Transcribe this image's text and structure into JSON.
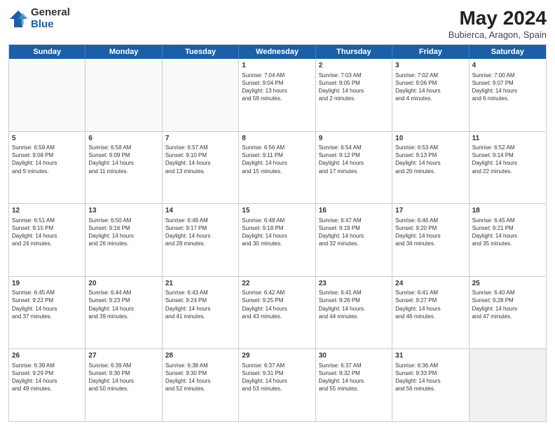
{
  "header": {
    "logo_general": "General",
    "logo_blue": "Blue",
    "month_title": "May 2024",
    "location": "Bubierca, Aragon, Spain"
  },
  "weekdays": [
    "Sunday",
    "Monday",
    "Tuesday",
    "Wednesday",
    "Thursday",
    "Friday",
    "Saturday"
  ],
  "rows": [
    [
      {
        "day": "",
        "info": "",
        "empty": true
      },
      {
        "day": "",
        "info": "",
        "empty": true
      },
      {
        "day": "",
        "info": "",
        "empty": true
      },
      {
        "day": "1",
        "info": "Sunrise: 7:04 AM\nSunset: 9:04 PM\nDaylight: 13 hours\nand 59 minutes."
      },
      {
        "day": "2",
        "info": "Sunrise: 7:03 AM\nSunset: 9:05 PM\nDaylight: 14 hours\nand 2 minutes."
      },
      {
        "day": "3",
        "info": "Sunrise: 7:02 AM\nSunset: 9:06 PM\nDaylight: 14 hours\nand 4 minutes."
      },
      {
        "day": "4",
        "info": "Sunrise: 7:00 AM\nSunset: 9:07 PM\nDaylight: 14 hours\nand 6 minutes."
      }
    ],
    [
      {
        "day": "5",
        "info": "Sunrise: 6:59 AM\nSunset: 9:08 PM\nDaylight: 14 hours\nand 9 minutes."
      },
      {
        "day": "6",
        "info": "Sunrise: 6:58 AM\nSunset: 9:09 PM\nDaylight: 14 hours\nand 11 minutes."
      },
      {
        "day": "7",
        "info": "Sunrise: 6:57 AM\nSunset: 9:10 PM\nDaylight: 14 hours\nand 13 minutes."
      },
      {
        "day": "8",
        "info": "Sunrise: 6:56 AM\nSunset: 9:11 PM\nDaylight: 14 hours\nand 15 minutes."
      },
      {
        "day": "9",
        "info": "Sunrise: 6:54 AM\nSunset: 9:12 PM\nDaylight: 14 hours\nand 17 minutes."
      },
      {
        "day": "10",
        "info": "Sunrise: 6:53 AM\nSunset: 9:13 PM\nDaylight: 14 hours\nand 20 minutes."
      },
      {
        "day": "11",
        "info": "Sunrise: 6:52 AM\nSunset: 9:14 PM\nDaylight: 14 hours\nand 22 minutes."
      }
    ],
    [
      {
        "day": "12",
        "info": "Sunrise: 6:51 AM\nSunset: 9:15 PM\nDaylight: 14 hours\nand 24 minutes."
      },
      {
        "day": "13",
        "info": "Sunrise: 6:50 AM\nSunset: 9:16 PM\nDaylight: 14 hours\nand 26 minutes."
      },
      {
        "day": "14",
        "info": "Sunrise: 6:49 AM\nSunset: 9:17 PM\nDaylight: 14 hours\nand 28 minutes."
      },
      {
        "day": "15",
        "info": "Sunrise: 6:48 AM\nSunset: 9:18 PM\nDaylight: 14 hours\nand 30 minutes."
      },
      {
        "day": "16",
        "info": "Sunrise: 6:47 AM\nSunset: 9:19 PM\nDaylight: 14 hours\nand 32 minutes."
      },
      {
        "day": "17",
        "info": "Sunrise: 6:46 AM\nSunset: 9:20 PM\nDaylight: 14 hours\nand 34 minutes."
      },
      {
        "day": "18",
        "info": "Sunrise: 6:45 AM\nSunset: 9:21 PM\nDaylight: 14 hours\nand 35 minutes."
      }
    ],
    [
      {
        "day": "19",
        "info": "Sunrise: 6:45 AM\nSunset: 9:22 PM\nDaylight: 14 hours\nand 37 minutes."
      },
      {
        "day": "20",
        "info": "Sunrise: 6:44 AM\nSunset: 9:23 PM\nDaylight: 14 hours\nand 39 minutes."
      },
      {
        "day": "21",
        "info": "Sunrise: 6:43 AM\nSunset: 9:24 PM\nDaylight: 14 hours\nand 41 minutes."
      },
      {
        "day": "22",
        "info": "Sunrise: 6:42 AM\nSunset: 9:25 PM\nDaylight: 14 hours\nand 43 minutes."
      },
      {
        "day": "23",
        "info": "Sunrise: 6:41 AM\nSunset: 9:26 PM\nDaylight: 14 hours\nand 44 minutes."
      },
      {
        "day": "24",
        "info": "Sunrise: 6:41 AM\nSunset: 9:27 PM\nDaylight: 14 hours\nand 46 minutes."
      },
      {
        "day": "25",
        "info": "Sunrise: 6:40 AM\nSunset: 9:28 PM\nDaylight: 14 hours\nand 47 minutes."
      }
    ],
    [
      {
        "day": "26",
        "info": "Sunrise: 6:39 AM\nSunset: 9:29 PM\nDaylight: 14 hours\nand 49 minutes."
      },
      {
        "day": "27",
        "info": "Sunrise: 6:39 AM\nSunset: 9:30 PM\nDaylight: 14 hours\nand 50 minutes."
      },
      {
        "day": "28",
        "info": "Sunrise: 6:38 AM\nSunset: 9:30 PM\nDaylight: 14 hours\nand 52 minutes."
      },
      {
        "day": "29",
        "info": "Sunrise: 6:37 AM\nSunset: 9:31 PM\nDaylight: 14 hours\nand 53 minutes."
      },
      {
        "day": "30",
        "info": "Sunrise: 6:37 AM\nSunset: 9:32 PM\nDaylight: 14 hours\nand 55 minutes."
      },
      {
        "day": "31",
        "info": "Sunrise: 6:36 AM\nSunset: 9:33 PM\nDaylight: 14 hours\nand 56 minutes."
      },
      {
        "day": "",
        "info": "",
        "empty": true,
        "shaded": true
      }
    ]
  ]
}
